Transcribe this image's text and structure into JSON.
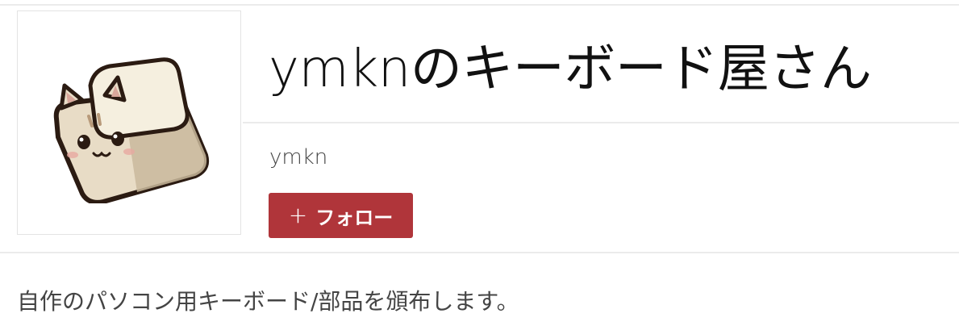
{
  "shop": {
    "title": "ymknのキーボード屋さん",
    "owner": "ymkn",
    "follow_plus": "+",
    "follow_label": "フォロー",
    "description": "自作のパソコン用キーボード/部品を頒布します。"
  },
  "avatar": {
    "icon": "cat-keycap-icon"
  },
  "colors": {
    "follow_button": "#b0353a",
    "divider": "#ebebeb",
    "text_muted": "#444444"
  }
}
